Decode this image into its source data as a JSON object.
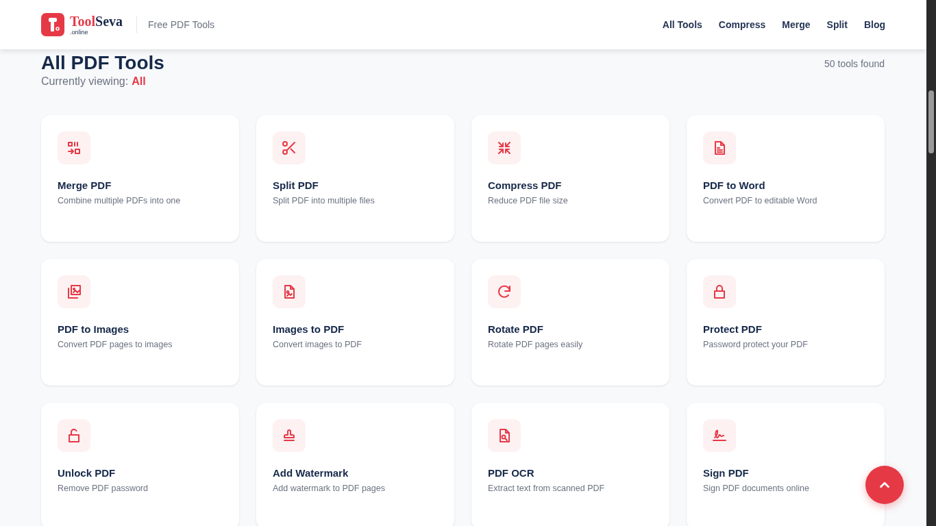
{
  "header": {
    "logo": {
      "name_part1": "Tool",
      "name_part2": "Seva",
      "suffix": ".online"
    },
    "tagline": "Free PDF Tools",
    "nav": [
      {
        "label": "All Tools"
      },
      {
        "label": "Compress"
      },
      {
        "label": "Merge"
      },
      {
        "label": "Split"
      },
      {
        "label": "Blog"
      }
    ]
  },
  "page": {
    "title": "All PDF Tools",
    "viewing_label": "Currently viewing:",
    "viewing_value": "All",
    "count": "50 tools found"
  },
  "tools": [
    {
      "title": "Merge PDF",
      "description": "Combine multiple PDFs into one"
    },
    {
      "title": "Split PDF",
      "description": "Split PDF into multiple files"
    },
    {
      "title": "Compress PDF",
      "description": "Reduce PDF file size"
    },
    {
      "title": "PDF to Word",
      "description": "Convert PDF to editable Word"
    },
    {
      "title": "PDF to Images",
      "description": "Convert PDF pages to images"
    },
    {
      "title": "Images to PDF",
      "description": "Convert images to PDF"
    },
    {
      "title": "Rotate PDF",
      "description": "Rotate PDF pages easily"
    },
    {
      "title": "Protect PDF",
      "description": "Password protect your PDF"
    },
    {
      "title": "Unlock PDF",
      "description": "Remove PDF password"
    },
    {
      "title": "Add Watermark",
      "description": "Add watermark to PDF pages"
    },
    {
      "title": "PDF OCR",
      "description": "Extract text from scanned PDF"
    },
    {
      "title": "Sign PDF",
      "description": "Sign PDF documents online"
    }
  ]
}
